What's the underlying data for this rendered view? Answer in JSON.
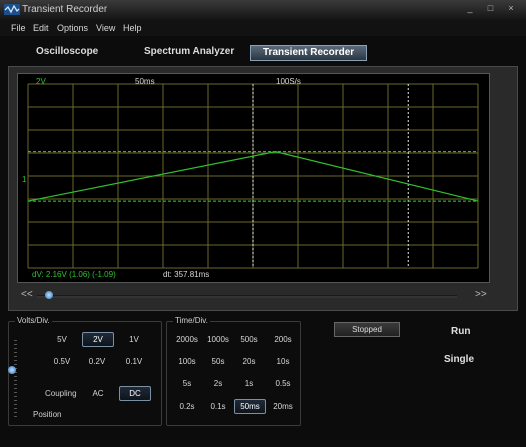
{
  "window": {
    "title": "Transient Recorder",
    "controls": [
      "_",
      "□",
      "×"
    ]
  },
  "menu": [
    "File",
    "Edit",
    "Options",
    "View",
    "Help"
  ],
  "modes": {
    "tabs": [
      "Oscilloscope",
      "Spectrum Analyzer",
      "Transient Recorder"
    ],
    "active": "Transient Recorder"
  },
  "scope": {
    "volts_per_div": "2V",
    "time_per_div": "50ms",
    "sample_rate": "100S/s",
    "channel_marker": "1",
    "measure_dv": "dV: 2.16V (1.06) (-1.09)",
    "measure_dt": "dt: 357.81ms",
    "trace_color": "#30c030",
    "grid_color": "#6a6a2a",
    "nav_left": "<<",
    "nav_right": ">>",
    "timeline_position": 0.02
  },
  "chart_data": {
    "type": "line",
    "x": [
      0,
      5.5,
      10
    ],
    "y": [
      -1.09,
      1.06,
      -1.09
    ],
    "x_divisions": 10,
    "y_divisions": 8,
    "xlim": [
      0,
      10
    ],
    "ylim": [
      -4,
      4
    ],
    "cursors_x": [
      5.0,
      8.45
    ],
    "cursors_y": [
      1.06,
      -1.09
    ],
    "grid": true
  },
  "volts_div": {
    "title": "Volts/Div.",
    "options": [
      "5V",
      "2V",
      "1V",
      "0.5V",
      "0.2V",
      "0.1V"
    ],
    "selected": "2V",
    "coupling_label": "Coupling",
    "coupling_options": [
      "AC",
      "DC"
    ],
    "coupling_selected": "DC",
    "position_label": "Position"
  },
  "time_div": {
    "title": "Time/Div.",
    "options": [
      "2000s",
      "1000s",
      "500s",
      "200s",
      "100s",
      "50s",
      "20s",
      "10s",
      "5s",
      "2s",
      "1s",
      "0.5s",
      "0.2s",
      "0.1s",
      "50ms",
      "20ms"
    ],
    "selected": "50ms"
  },
  "controls": {
    "status": "Stopped",
    "run_label": "Run",
    "single_label": "Single"
  }
}
